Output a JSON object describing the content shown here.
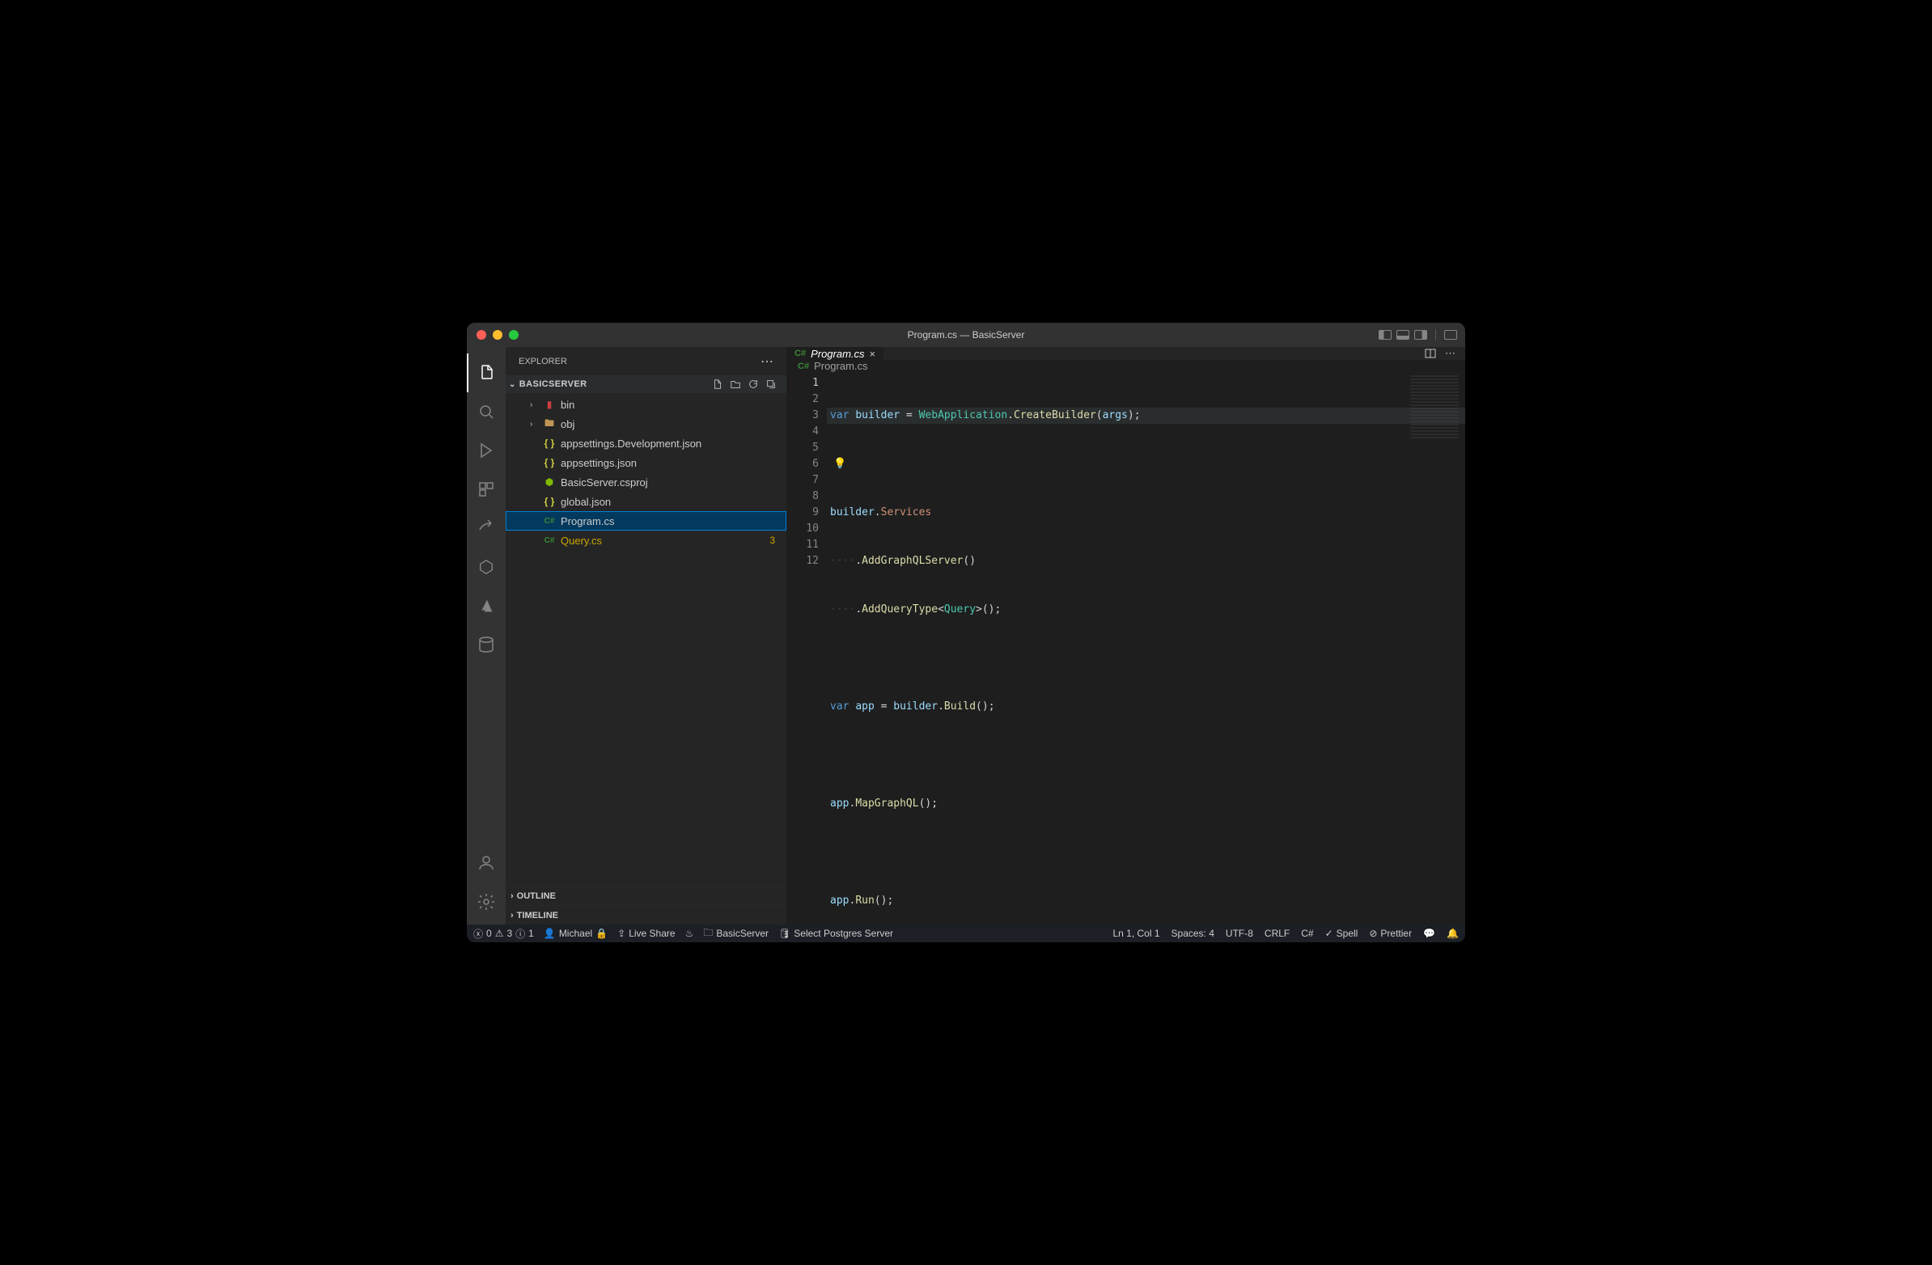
{
  "window": {
    "title": "Program.cs — BasicServer"
  },
  "sidebar": {
    "title": "EXPLORER",
    "project": "BASICSERVER",
    "sections": {
      "outline": "OUTLINE",
      "timeline": "TIMELINE"
    }
  },
  "files": [
    {
      "name": "bin",
      "type": "folder",
      "icon": "bin"
    },
    {
      "name": "obj",
      "type": "folder",
      "icon": "folder"
    },
    {
      "name": "appsettings.Development.json",
      "type": "file",
      "icon": "json"
    },
    {
      "name": "appsettings.json",
      "type": "file",
      "icon": "json"
    },
    {
      "name": "BasicServer.csproj",
      "type": "file",
      "icon": "csproj"
    },
    {
      "name": "global.json",
      "type": "file",
      "icon": "json"
    },
    {
      "name": "Program.cs",
      "type": "file",
      "icon": "cs",
      "selected": true
    },
    {
      "name": "Query.cs",
      "type": "file",
      "icon": "cs",
      "warn": true,
      "badge": "3"
    }
  ],
  "tab": {
    "icon": "C#",
    "label": "Program.cs"
  },
  "breadcrumb": {
    "icon": "C#",
    "label": "Program.cs"
  },
  "code": {
    "line1": {
      "kw": "var",
      "id": "builder",
      "eq": " = ",
      "type": "WebApplication",
      "dot": ".",
      "fn": "CreateBuilder",
      "paren": "(",
      "arg": "args",
      "end": ");"
    },
    "line3": {
      "id": "builder",
      "dot": ".",
      "prop": "Services"
    },
    "line4": {
      "ws": "····",
      "dot": ".",
      "fn": "AddGraphQLServer",
      "parens": "()"
    },
    "line5": {
      "ws": "····",
      "dot": ".",
      "fn": "AddQueryType",
      "lt": "<",
      "type": "Query",
      "gt": ">",
      "parens": "();"
    },
    "line7": {
      "kw": "var",
      "id": "app",
      "eq": " = ",
      "obj": "builder",
      "dot": ".",
      "fn": "Build",
      "parens": "();"
    },
    "line9": {
      "id": "app",
      "dot": ".",
      "fn": "MapGraphQL",
      "parens": "();"
    },
    "line11": {
      "id": "app",
      "dot": ".",
      "fn": "Run",
      "parens": "();"
    }
  },
  "lines": [
    "1",
    "2",
    "3",
    "4",
    "5",
    "6",
    "7",
    "8",
    "9",
    "10",
    "11",
    "12"
  ],
  "statusbar": {
    "errors": "0",
    "warnings": "3",
    "info": "1",
    "user": "Michael",
    "liveshare": "Live Share",
    "folder": "BasicServer",
    "postgres": "Select Postgres Server",
    "position": "Ln 1, Col 1",
    "spaces": "Spaces: 4",
    "encoding": "UTF-8",
    "eol": "CRLF",
    "language": "C#",
    "spell": "Spell",
    "prettier": "Prettier"
  }
}
